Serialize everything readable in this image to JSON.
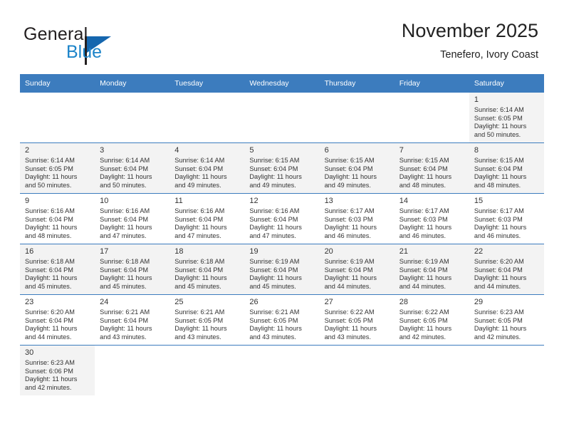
{
  "brand": {
    "name_part1": "General",
    "name_part2": "Blue",
    "logo_icon": "triangle-logo-icon"
  },
  "header": {
    "month_title": "November 2025",
    "location": "Tenefero, Ivory Coast"
  },
  "colors": {
    "header_blue": "#3c7cbe",
    "brand_blue": "#1d84c9",
    "row_shade": "#f3f3f3",
    "text": "#333333"
  },
  "calendar": {
    "weekday_headers": [
      "Sunday",
      "Monday",
      "Tuesday",
      "Wednesday",
      "Thursday",
      "Friday",
      "Saturday"
    ],
    "weeks": [
      {
        "shaded": true,
        "days": [
          {
            "num": "",
            "sunrise": "",
            "sunset": "",
            "daylight1": "",
            "daylight2": "",
            "empty": true
          },
          {
            "num": "",
            "sunrise": "",
            "sunset": "",
            "daylight1": "",
            "daylight2": "",
            "empty": true
          },
          {
            "num": "",
            "sunrise": "",
            "sunset": "",
            "daylight1": "",
            "daylight2": "",
            "empty": true
          },
          {
            "num": "",
            "sunrise": "",
            "sunset": "",
            "daylight1": "",
            "daylight2": "",
            "empty": true
          },
          {
            "num": "",
            "sunrise": "",
            "sunset": "",
            "daylight1": "",
            "daylight2": "",
            "empty": true
          },
          {
            "num": "",
            "sunrise": "",
            "sunset": "",
            "daylight1": "",
            "daylight2": "",
            "empty": true
          },
          {
            "num": "1",
            "sunrise": "Sunrise: 6:14 AM",
            "sunset": "Sunset: 6:05 PM",
            "daylight1": "Daylight: 11 hours",
            "daylight2": "and 50 minutes.",
            "empty": false
          }
        ]
      },
      {
        "shaded": true,
        "days": [
          {
            "num": "2",
            "sunrise": "Sunrise: 6:14 AM",
            "sunset": "Sunset: 6:05 PM",
            "daylight1": "Daylight: 11 hours",
            "daylight2": "and 50 minutes.",
            "empty": false
          },
          {
            "num": "3",
            "sunrise": "Sunrise: 6:14 AM",
            "sunset": "Sunset: 6:04 PM",
            "daylight1": "Daylight: 11 hours",
            "daylight2": "and 50 minutes.",
            "empty": false
          },
          {
            "num": "4",
            "sunrise": "Sunrise: 6:14 AM",
            "sunset": "Sunset: 6:04 PM",
            "daylight1": "Daylight: 11 hours",
            "daylight2": "and 49 minutes.",
            "empty": false
          },
          {
            "num": "5",
            "sunrise": "Sunrise: 6:15 AM",
            "sunset": "Sunset: 6:04 PM",
            "daylight1": "Daylight: 11 hours",
            "daylight2": "and 49 minutes.",
            "empty": false
          },
          {
            "num": "6",
            "sunrise": "Sunrise: 6:15 AM",
            "sunset": "Sunset: 6:04 PM",
            "daylight1": "Daylight: 11 hours",
            "daylight2": "and 49 minutes.",
            "empty": false
          },
          {
            "num": "7",
            "sunrise": "Sunrise: 6:15 AM",
            "sunset": "Sunset: 6:04 PM",
            "daylight1": "Daylight: 11 hours",
            "daylight2": "and 48 minutes.",
            "empty": false
          },
          {
            "num": "8",
            "sunrise": "Sunrise: 6:15 AM",
            "sunset": "Sunset: 6:04 PM",
            "daylight1": "Daylight: 11 hours",
            "daylight2": "and 48 minutes.",
            "empty": false
          }
        ]
      },
      {
        "shaded": false,
        "days": [
          {
            "num": "9",
            "sunrise": "Sunrise: 6:16 AM",
            "sunset": "Sunset: 6:04 PM",
            "daylight1": "Daylight: 11 hours",
            "daylight2": "and 48 minutes.",
            "empty": false
          },
          {
            "num": "10",
            "sunrise": "Sunrise: 6:16 AM",
            "sunset": "Sunset: 6:04 PM",
            "daylight1": "Daylight: 11 hours",
            "daylight2": "and 47 minutes.",
            "empty": false
          },
          {
            "num": "11",
            "sunrise": "Sunrise: 6:16 AM",
            "sunset": "Sunset: 6:04 PM",
            "daylight1": "Daylight: 11 hours",
            "daylight2": "and 47 minutes.",
            "empty": false
          },
          {
            "num": "12",
            "sunrise": "Sunrise: 6:16 AM",
            "sunset": "Sunset: 6:04 PM",
            "daylight1": "Daylight: 11 hours",
            "daylight2": "and 47 minutes.",
            "empty": false
          },
          {
            "num": "13",
            "sunrise": "Sunrise: 6:17 AM",
            "sunset": "Sunset: 6:03 PM",
            "daylight1": "Daylight: 11 hours",
            "daylight2": "and 46 minutes.",
            "empty": false
          },
          {
            "num": "14",
            "sunrise": "Sunrise: 6:17 AM",
            "sunset": "Sunset: 6:03 PM",
            "daylight1": "Daylight: 11 hours",
            "daylight2": "and 46 minutes.",
            "empty": false
          },
          {
            "num": "15",
            "sunrise": "Sunrise: 6:17 AM",
            "sunset": "Sunset: 6:03 PM",
            "daylight1": "Daylight: 11 hours",
            "daylight2": "and 46 minutes.",
            "empty": false
          }
        ]
      },
      {
        "shaded": true,
        "days": [
          {
            "num": "16",
            "sunrise": "Sunrise: 6:18 AM",
            "sunset": "Sunset: 6:04 PM",
            "daylight1": "Daylight: 11 hours",
            "daylight2": "and 45 minutes.",
            "empty": false
          },
          {
            "num": "17",
            "sunrise": "Sunrise: 6:18 AM",
            "sunset": "Sunset: 6:04 PM",
            "daylight1": "Daylight: 11 hours",
            "daylight2": "and 45 minutes.",
            "empty": false
          },
          {
            "num": "18",
            "sunrise": "Sunrise: 6:18 AM",
            "sunset": "Sunset: 6:04 PM",
            "daylight1": "Daylight: 11 hours",
            "daylight2": "and 45 minutes.",
            "empty": false
          },
          {
            "num": "19",
            "sunrise": "Sunrise: 6:19 AM",
            "sunset": "Sunset: 6:04 PM",
            "daylight1": "Daylight: 11 hours",
            "daylight2": "and 45 minutes.",
            "empty": false
          },
          {
            "num": "20",
            "sunrise": "Sunrise: 6:19 AM",
            "sunset": "Sunset: 6:04 PM",
            "daylight1": "Daylight: 11 hours",
            "daylight2": "and 44 minutes.",
            "empty": false
          },
          {
            "num": "21",
            "sunrise": "Sunrise: 6:19 AM",
            "sunset": "Sunset: 6:04 PM",
            "daylight1": "Daylight: 11 hours",
            "daylight2": "and 44 minutes.",
            "empty": false
          },
          {
            "num": "22",
            "sunrise": "Sunrise: 6:20 AM",
            "sunset": "Sunset: 6:04 PM",
            "daylight1": "Daylight: 11 hours",
            "daylight2": "and 44 minutes.",
            "empty": false
          }
        ]
      },
      {
        "shaded": false,
        "days": [
          {
            "num": "23",
            "sunrise": "Sunrise: 6:20 AM",
            "sunset": "Sunset: 6:04 PM",
            "daylight1": "Daylight: 11 hours",
            "daylight2": "and 44 minutes.",
            "empty": false
          },
          {
            "num": "24",
            "sunrise": "Sunrise: 6:21 AM",
            "sunset": "Sunset: 6:04 PM",
            "daylight1": "Daylight: 11 hours",
            "daylight2": "and 43 minutes.",
            "empty": false
          },
          {
            "num": "25",
            "sunrise": "Sunrise: 6:21 AM",
            "sunset": "Sunset: 6:05 PM",
            "daylight1": "Daylight: 11 hours",
            "daylight2": "and 43 minutes.",
            "empty": false
          },
          {
            "num": "26",
            "sunrise": "Sunrise: 6:21 AM",
            "sunset": "Sunset: 6:05 PM",
            "daylight1": "Daylight: 11 hours",
            "daylight2": "and 43 minutes.",
            "empty": false
          },
          {
            "num": "27",
            "sunrise": "Sunrise: 6:22 AM",
            "sunset": "Sunset: 6:05 PM",
            "daylight1": "Daylight: 11 hours",
            "daylight2": "and 43 minutes.",
            "empty": false
          },
          {
            "num": "28",
            "sunrise": "Sunrise: 6:22 AM",
            "sunset": "Sunset: 6:05 PM",
            "daylight1": "Daylight: 11 hours",
            "daylight2": "and 42 minutes.",
            "empty": false
          },
          {
            "num": "29",
            "sunrise": "Sunrise: 6:23 AM",
            "sunset": "Sunset: 6:05 PM",
            "daylight1": "Daylight: 11 hours",
            "daylight2": "and 42 minutes.",
            "empty": false
          }
        ]
      },
      {
        "shaded": true,
        "days": [
          {
            "num": "30",
            "sunrise": "Sunrise: 6:23 AM",
            "sunset": "Sunset: 6:06 PM",
            "daylight1": "Daylight: 11 hours",
            "daylight2": "and 42 minutes.",
            "empty": false
          },
          {
            "num": "",
            "sunrise": "",
            "sunset": "",
            "daylight1": "",
            "daylight2": "",
            "empty": true
          },
          {
            "num": "",
            "sunrise": "",
            "sunset": "",
            "daylight1": "",
            "daylight2": "",
            "empty": true
          },
          {
            "num": "",
            "sunrise": "",
            "sunset": "",
            "daylight1": "",
            "daylight2": "",
            "empty": true
          },
          {
            "num": "",
            "sunrise": "",
            "sunset": "",
            "daylight1": "",
            "daylight2": "",
            "empty": true
          },
          {
            "num": "",
            "sunrise": "",
            "sunset": "",
            "daylight1": "",
            "daylight2": "",
            "empty": true
          },
          {
            "num": "",
            "sunrise": "",
            "sunset": "",
            "daylight1": "",
            "daylight2": "",
            "empty": true
          }
        ]
      }
    ]
  }
}
